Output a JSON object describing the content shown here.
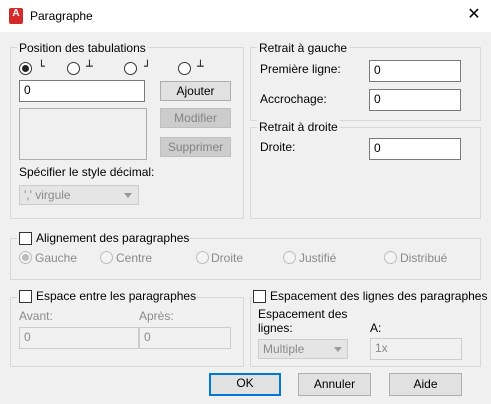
{
  "window": {
    "title": "Paragraphe",
    "app_icon": "A"
  },
  "tabs": {
    "legend": "Position des tabulations",
    "symbols": [
      "└",
      "┴",
      "┘",
      "┴"
    ],
    "position_value": "0",
    "add": "Ajouter",
    "modify": "Modifier",
    "delete": "Supprimer",
    "decimal_label": "Spécifier le style décimal:",
    "decimal_value": "',' virgule"
  },
  "left_indent": {
    "legend": "Retrait à gauche",
    "first_line_label": "Première ligne:",
    "first_line_value": "0",
    "hanging_label": "Accrochage:",
    "hanging_value": "0"
  },
  "right_indent": {
    "legend": "Retrait à droite",
    "right_label": "Droite:",
    "right_value": "0"
  },
  "alignment": {
    "label": "Alignement des paragraphes",
    "options": [
      "Gauche",
      "Centre",
      "Droite",
      "Justifié",
      "Distribué"
    ]
  },
  "spacing": {
    "label": "Espace entre les paragraphes",
    "before_label": "Avant:",
    "before_value": "0",
    "after_label": "Après:",
    "after_value": "0"
  },
  "line_spacing": {
    "label": "Espacement des lignes des paragraphes",
    "spacing_label_1": "Espacement des",
    "spacing_label_2": "lignes:",
    "spacing_value": "Multiple",
    "at_label": "A:",
    "at_value": "1x"
  },
  "footer": {
    "ok": "OK",
    "cancel": "Annuler",
    "help": "Aide"
  }
}
